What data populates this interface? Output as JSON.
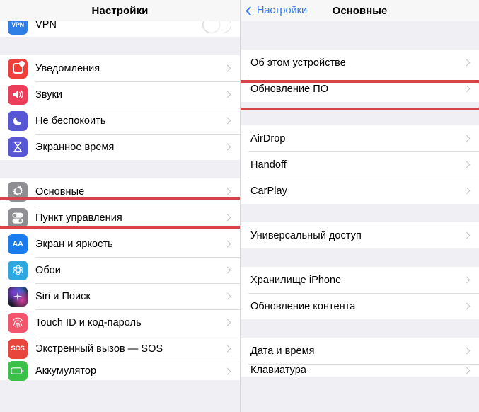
{
  "left_panel": {
    "nav": {
      "title": "Настройки"
    },
    "groups": [
      {
        "id": "g0",
        "rows": [
          {
            "label": "VPN",
            "icon": "vpn-icon",
            "accessory": "toggle",
            "partial": true
          }
        ]
      },
      {
        "id": "g1",
        "rows": [
          {
            "label": "Уведомления",
            "icon": "notifications-icon",
            "accessory": "chevron"
          },
          {
            "label": "Звуки",
            "icon": "sounds-icon",
            "accessory": "chevron"
          },
          {
            "label": "Не беспокоить",
            "icon": "do-not-disturb-icon",
            "accessory": "chevron"
          },
          {
            "label": "Экранное время",
            "icon": "screen-time-icon",
            "accessory": "chevron"
          }
        ]
      },
      {
        "id": "g2",
        "rows": [
          {
            "label": "Основные",
            "icon": "general-gear-icon",
            "accessory": "chevron",
            "highlighted": true
          },
          {
            "label": "Пункт управления",
            "icon": "control-center-icon",
            "accessory": "chevron"
          },
          {
            "label": "Экран и яркость",
            "icon": "display-brightness-icon",
            "accessory": "chevron"
          },
          {
            "label": "Обои",
            "icon": "wallpaper-icon",
            "accessory": "chevron"
          },
          {
            "label": "Siri и Поиск",
            "icon": "siri-icon",
            "accessory": "chevron"
          },
          {
            "label": "Touch ID и код-пароль",
            "icon": "touch-id-icon",
            "accessory": "chevron"
          },
          {
            "label": "Экстренный вызов — SOS",
            "icon": "sos-icon",
            "accessory": "chevron"
          },
          {
            "label": "Аккумулятор",
            "icon": "battery-icon",
            "accessory": "chevron",
            "partial": true
          }
        ]
      }
    ]
  },
  "right_panel": {
    "nav": {
      "back_label": "Настройки",
      "title": "Основные"
    },
    "groups": [
      {
        "id": "r1",
        "rows": [
          {
            "label": "Об этом устройстве",
            "accessory": "chevron"
          },
          {
            "label": "Обновление ПО",
            "accessory": "chevron",
            "highlighted": true
          }
        ]
      },
      {
        "id": "r2",
        "rows": [
          {
            "label": "AirDrop",
            "accessory": "chevron"
          },
          {
            "label": "Handoff",
            "accessory": "chevron"
          },
          {
            "label": "CarPlay",
            "accessory": "chevron"
          }
        ]
      },
      {
        "id": "r3",
        "rows": [
          {
            "label": "Универсальный доступ",
            "accessory": "chevron"
          }
        ]
      },
      {
        "id": "r4",
        "rows": [
          {
            "label": "Хранилище iPhone",
            "accessory": "chevron"
          },
          {
            "label": "Обновление контента",
            "accessory": "chevron"
          }
        ]
      },
      {
        "id": "r5",
        "rows": [
          {
            "label": "Дата и время",
            "accessory": "chevron"
          },
          {
            "label": "Клавиатура",
            "accessory": "chevron",
            "partial": true
          }
        ]
      }
    ]
  },
  "colors": {
    "highlight": "#d64348",
    "accent_blue": "#3478f6",
    "group_bg": "#ffffff",
    "page_bg": "#efeff4"
  }
}
